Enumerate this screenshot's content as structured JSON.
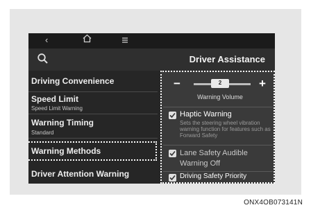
{
  "nav": {
    "back_icon": "chevron-left-icon",
    "home_icon": "home-icon",
    "menu_icon": "menu-icon"
  },
  "header": {
    "title": "Driver Assistance"
  },
  "menu": {
    "items": [
      {
        "label": "Driving Convenience",
        "sub": ""
      },
      {
        "label": "Speed Limit",
        "sub": "Speed Limit Warning"
      },
      {
        "label": "Warning Timing",
        "sub": "Standard"
      },
      {
        "label": "Warning Methods",
        "sub": ""
      },
      {
        "label": "Driver Attention Warning",
        "sub": ""
      }
    ],
    "selected_index": 3
  },
  "settings": {
    "volume": {
      "value": "2",
      "label": "Warning Volume",
      "minus": "−",
      "plus": "+"
    },
    "options": [
      {
        "label": "Haptic Warning",
        "checked": true,
        "description": "Sets the steering wheel vibration warning function for features such as Forward Safety"
      },
      {
        "label": "Lane Safety Audible Warning Off",
        "checked": true
      },
      {
        "label": "Driving Safety Priority",
        "checked": true
      }
    ]
  },
  "caption": "ONX4OB073141N",
  "colors": {
    "screen_bg": "#262626",
    "panel_bg": "#e6e6e6",
    "highlight_border": "#ffffff"
  }
}
